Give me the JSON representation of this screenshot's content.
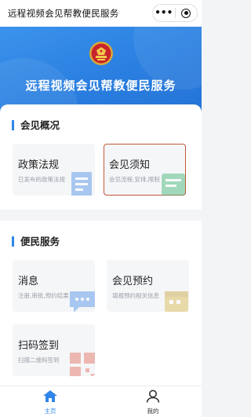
{
  "nav": {
    "title": "远程视频会见帮教便民服务",
    "more_icon": "more-dots-icon",
    "close_icon": "close-circle-icon"
  },
  "hero": {
    "title": "远程视频会见帮教便民服务",
    "emblem_icon": "national-emblem-icon",
    "bg_color": "#2f86e8"
  },
  "sections": [
    {
      "title": "会见概况",
      "tiles": [
        {
          "title": "政策法规",
          "subtitle": "已发布的政策法规",
          "icon": "document-icon",
          "accent": "#4d8fe6"
        },
        {
          "title": "会见须知",
          "subtitle": "会见流程,安排,限制",
          "icon": "notice-icon",
          "accent": "#3cb371"
        }
      ]
    },
    {
      "title": "便民服务",
      "tiles": [
        {
          "title": "消息",
          "subtitle": "注册,审批,预约结果",
          "icon": "message-icon",
          "accent": "#4d8fe6"
        },
        {
          "title": "会见预约",
          "subtitle": "填报预约相关信息",
          "icon": "calendar-icon",
          "accent": "#d9b64a"
        },
        {
          "title": "扫码签到",
          "subtitle": "扫描二维码签到",
          "icon": "qrcode-icon",
          "accent": "#e06a5a"
        }
      ]
    }
  ],
  "tabbar": {
    "items": [
      {
        "label": "主页",
        "icon": "home-icon",
        "active": true
      },
      {
        "label": "我的",
        "icon": "user-icon",
        "active": false
      }
    ]
  },
  "colors": {
    "accent": "#2f86e8",
    "highlight_border": "#c0583c"
  }
}
